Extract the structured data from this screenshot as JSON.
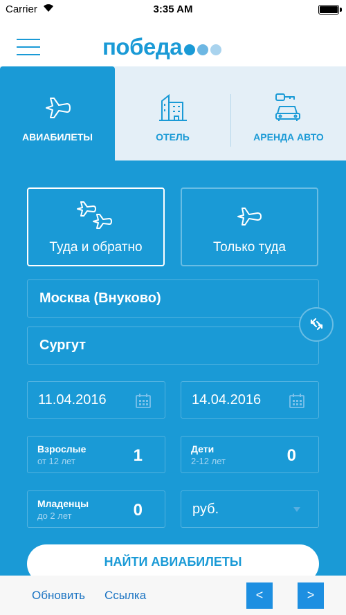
{
  "status_bar": {
    "carrier": "Carrier",
    "time": "3:35 AM"
  },
  "brand": {
    "logo_text": "победа",
    "accent": "#1a9ad6"
  },
  "tabs": [
    {
      "label": "АВИАБИЛЕТЫ",
      "icon": "plane-icon",
      "active": true
    },
    {
      "label": "ОТЕЛЬ",
      "icon": "hotel-icon",
      "active": false
    },
    {
      "label": "АРЕНДА АВТО",
      "icon": "car-rental-icon",
      "active": false
    }
  ],
  "trip_types": [
    {
      "label": "Туда и обратно",
      "icon": "two-planes-icon",
      "selected": true
    },
    {
      "label": "Только туда",
      "icon": "plane-icon",
      "selected": false
    }
  ],
  "route": {
    "from": "Москва (Внуково)",
    "to": "Сургут"
  },
  "dates": {
    "depart": "11.04.2016",
    "return": "14.04.2016"
  },
  "passengers": {
    "adults": {
      "title": "Взрослые",
      "subtitle": "от 12 лет",
      "count": "1"
    },
    "children": {
      "title": "Дети",
      "subtitle": "2-12 лет",
      "count": "0"
    },
    "infants": {
      "title": "Младенцы",
      "subtitle": "до 2 лет",
      "count": "0"
    }
  },
  "currency": {
    "value": "руб."
  },
  "search": {
    "label": "НАЙТИ АВИАБИЛЕТЫ"
  },
  "bottom_bar": {
    "refresh": "Обновить",
    "link": "Ссылка",
    "prev": "<",
    "next": ">"
  }
}
